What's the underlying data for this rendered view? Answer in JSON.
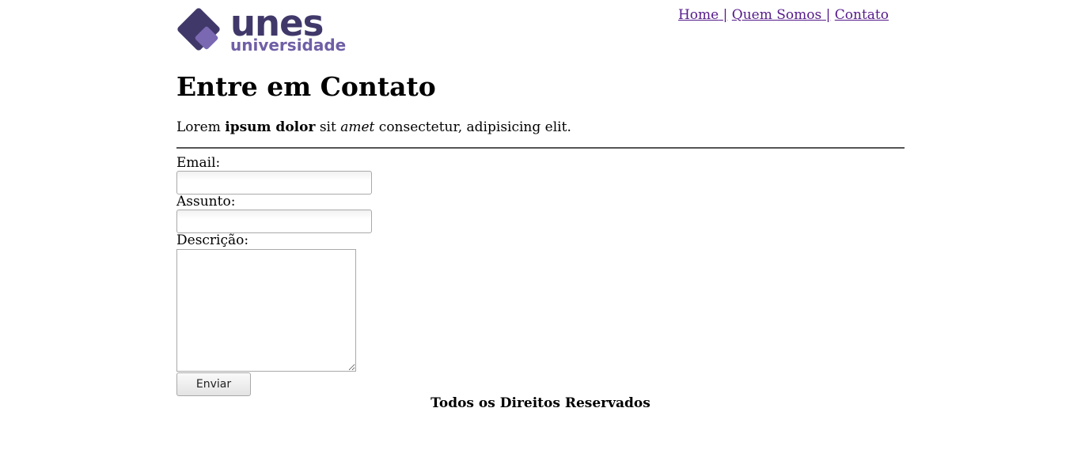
{
  "header": {
    "logo": {
      "word": "unes",
      "subword": "universidade",
      "primary_color": "#41386a",
      "secondary_color": "#6f5fa6"
    },
    "nav": {
      "home": "Home",
      "quem_somos": "Quem Somos",
      "contato": "Contato",
      "separator": "|",
      "link_color": "#551a8b"
    }
  },
  "main": {
    "title": "Entre em Contato",
    "intro": {
      "part1": "Lorem ",
      "bold": "ipsum dolor",
      "part2": " sit ",
      "italic": "amet",
      "part3": " consectetur, adipisicing elit."
    },
    "form": {
      "email_label": "Email:",
      "email_value": "",
      "assunto_label": "Assunto:",
      "assunto_value": "",
      "descricao_label": "Descrição:",
      "descricao_value": "",
      "submit_label": "Enviar"
    }
  },
  "footer": {
    "text": "Todos os Direitos Reservados"
  }
}
